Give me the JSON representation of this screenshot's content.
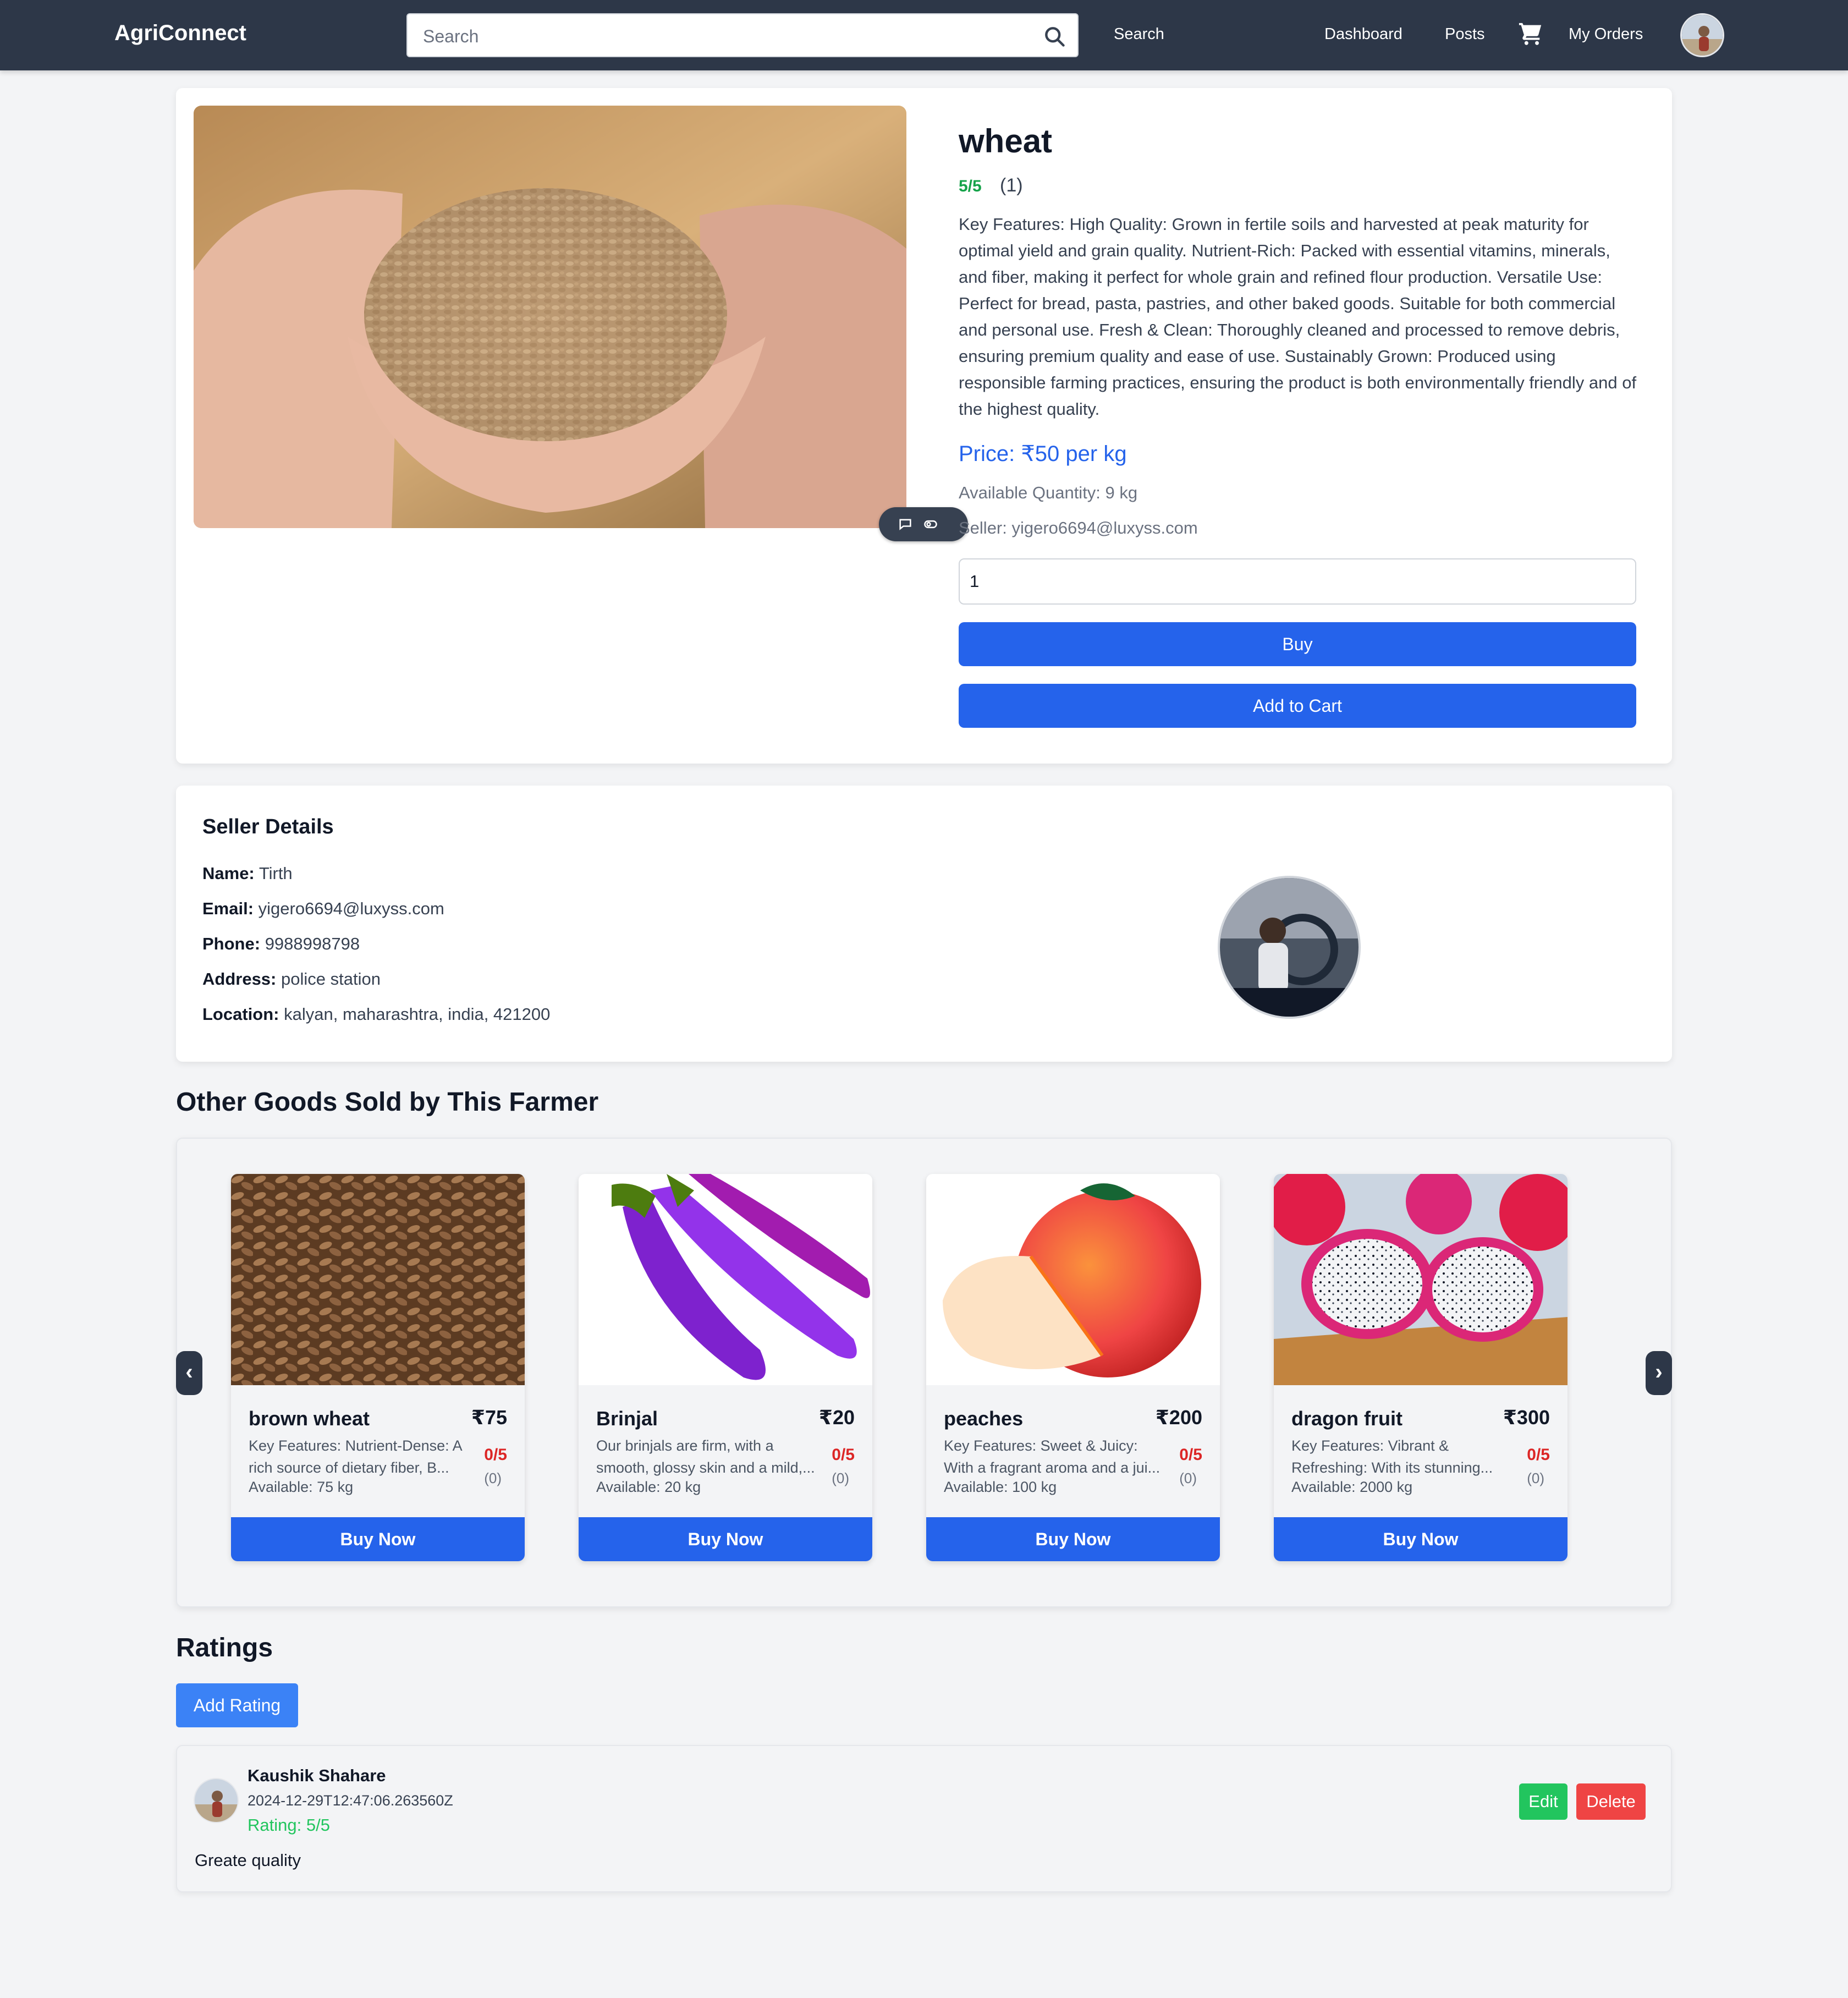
{
  "navbar": {
    "brand": "AgriConnect",
    "search_placeholder": "Search",
    "search_button": "Search",
    "links": [
      "Dashboard",
      "Posts"
    ],
    "orders": "My Orders"
  },
  "product": {
    "title": "wheat",
    "rating": "5/5",
    "rating_count": "(1)",
    "description": "Key Features: High Quality: Grown in fertile soils and harvested at peak maturity for optimal yield and grain quality. Nutrient-Rich: Packed with essential vitamins, minerals, and fiber, making it perfect for whole grain and refined flour production. Versatile Use: Perfect for bread, pasta, pastries, and other baked goods. Suitable for both commercial and personal use. Fresh & Clean: Thoroughly cleaned and processed to remove debris, ensuring premium quality and ease of use. Sustainably Grown: Produced using responsible farming practices, ensuring the product is both environmentally friendly and of the highest quality.",
    "price": "Price: ₹50 per kg",
    "available": "Available Quantity: 9 kg",
    "seller": "Seller: yigero6694@luxyss.com",
    "quantity_value": "1",
    "buy_label": "Buy",
    "cart_label": "Add to Cart"
  },
  "seller_details": {
    "heading": "Seller Details",
    "fields": [
      {
        "label": "Name:",
        "value": "Tirth"
      },
      {
        "label": "Email:",
        "value": "yigero6694@luxyss.com"
      },
      {
        "label": "Phone:",
        "value": "9988998798"
      },
      {
        "label": "Address:",
        "value": "police station"
      },
      {
        "label": "Location:",
        "value": "kalyan, maharashtra, india, 421200"
      }
    ]
  },
  "other_goods": {
    "heading": "Other Goods Sold by This Farmer",
    "prev": "‹",
    "next": "›",
    "items": [
      {
        "name": "brown wheat",
        "price": "₹75",
        "description": "Key Features: Nutrient-Dense: A rich source of dietary fiber, B...",
        "rating": "0/5",
        "rating_count": "(0)",
        "available": "Available: 75 kg",
        "buy": "Buy Now"
      },
      {
        "name": "Brinjal",
        "price": "₹20",
        "description": "Our brinjals are firm, with a smooth, glossy skin and a mild,...",
        "rating": "0/5",
        "rating_count": "(0)",
        "available": "Available: 20 kg",
        "buy": "Buy Now"
      },
      {
        "name": "peaches",
        "price": "₹200",
        "description": "Key Features: Sweet & Juicy: With a fragrant aroma and a jui...",
        "rating": "0/5",
        "rating_count": "(0)",
        "available": "Available: 100 kg",
        "buy": "Buy Now"
      },
      {
        "name": "dragon fruit",
        "price": "₹300",
        "description": "Key Features: Vibrant & Refreshing: With its stunning...",
        "rating": "0/5",
        "rating_count": "(0)",
        "available": "Available: 2000 kg",
        "buy": "Buy Now"
      }
    ]
  },
  "ratings": {
    "heading": "Ratings",
    "add_button": "Add Rating",
    "reviews": [
      {
        "name": "Kaushik Shahare",
        "date": "2024-12-29T12:47:06.263560Z",
        "score": "Rating: 5/5",
        "text": "Greate quality",
        "edit": "Edit",
        "delete": "Delete"
      }
    ]
  },
  "colors": {
    "navbar": "#2d3748",
    "primary": "#2563eb",
    "rating_good": "#16a34a",
    "rating_zero": "#dc2626",
    "edit": "#22c55e",
    "delete": "#ef4444"
  }
}
